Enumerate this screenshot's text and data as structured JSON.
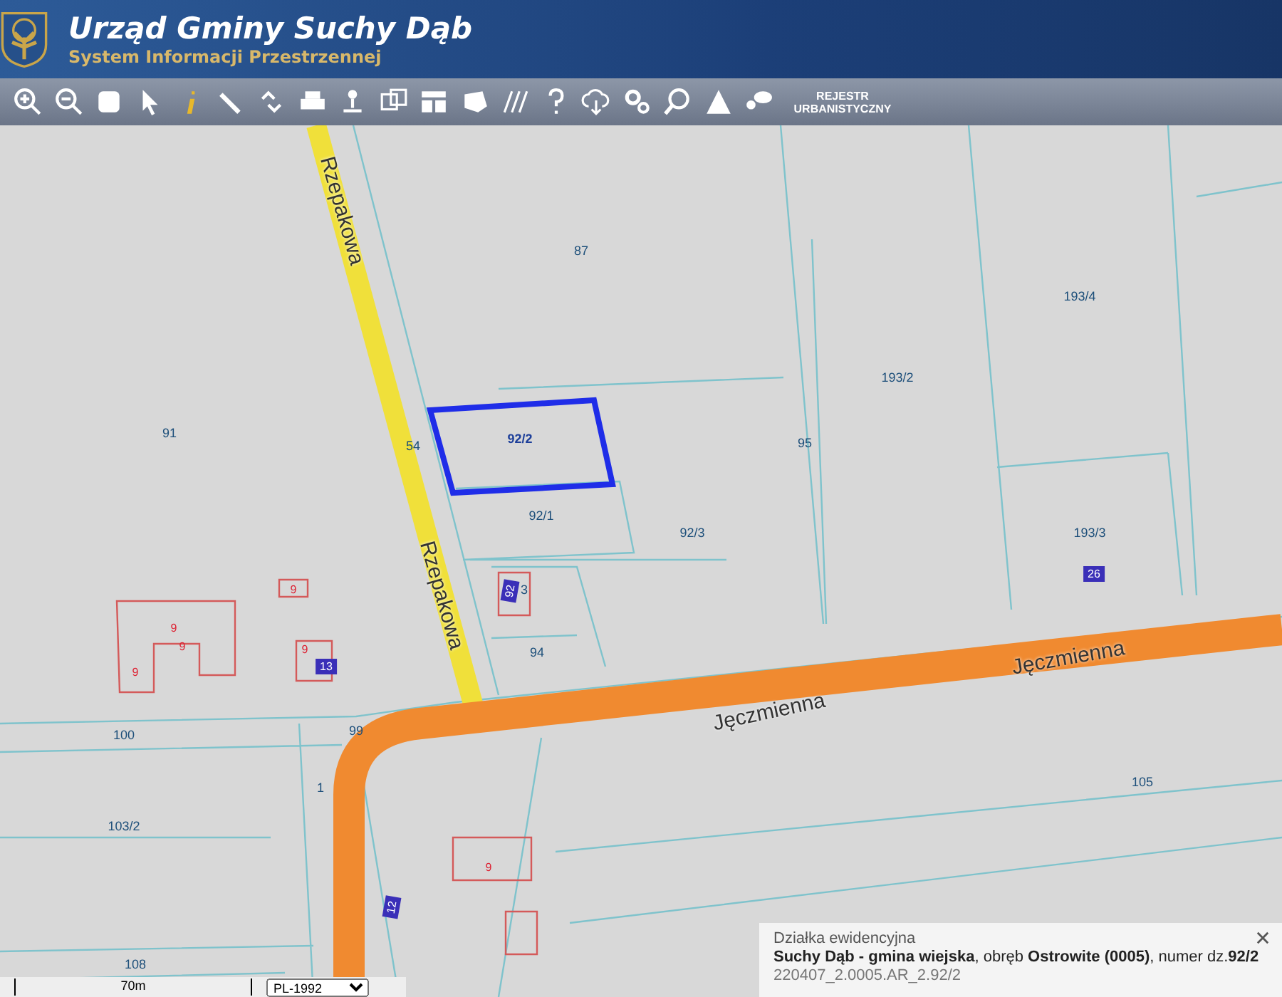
{
  "header": {
    "title": "Urząd Gminy Suchy Dąb",
    "subtitle": "System Informacji Przestrzennej"
  },
  "toolbar": {
    "register_button": "REJESTR URBANISTYCZNY"
  },
  "map": {
    "streets": [
      "Rzepakowa",
      "Rzepakowa",
      "Jęczmienna",
      "Jęczmienna"
    ],
    "parcels": [
      {
        "label": "87",
        "selected": false
      },
      {
        "label": "91",
        "selected": false
      },
      {
        "label": "92/2",
        "selected": true
      },
      {
        "label": "92/1",
        "selected": false
      },
      {
        "label": "92/3",
        "selected": false
      },
      {
        "label": "95",
        "selected": false
      },
      {
        "label": "193/2",
        "selected": false
      },
      {
        "label": "193/4",
        "selected": false
      },
      {
        "label": "193/3",
        "selected": false
      },
      {
        "label": "94",
        "selected": false
      },
      {
        "label": "100",
        "selected": false
      },
      {
        "label": "99",
        "selected": false
      },
      {
        "label": "103/2",
        "selected": false
      },
      {
        "label": "105",
        "selected": false
      },
      {
        "label": "108",
        "selected": false
      },
      {
        "label": "54",
        "selected": false
      },
      {
        "label": "3",
        "selected": false
      },
      {
        "label": "1",
        "selected": false
      }
    ],
    "building_labels": [
      "9",
      "9",
      "9",
      "9",
      "9",
      "9"
    ],
    "house_numbers": [
      "13",
      "26",
      "12",
      "92"
    ]
  },
  "info_panel": {
    "title": "Działka ewidencyjna",
    "description": "**Suchy Dąb - gmina wiejska**, obręb **Ostrowite (0005)**, numer dz.**92/2**",
    "identifier": "220407_2.0005.AR_2.92/2"
  },
  "scale_bar": {
    "label": "70m"
  },
  "projection": {
    "value": "PL-1992"
  }
}
